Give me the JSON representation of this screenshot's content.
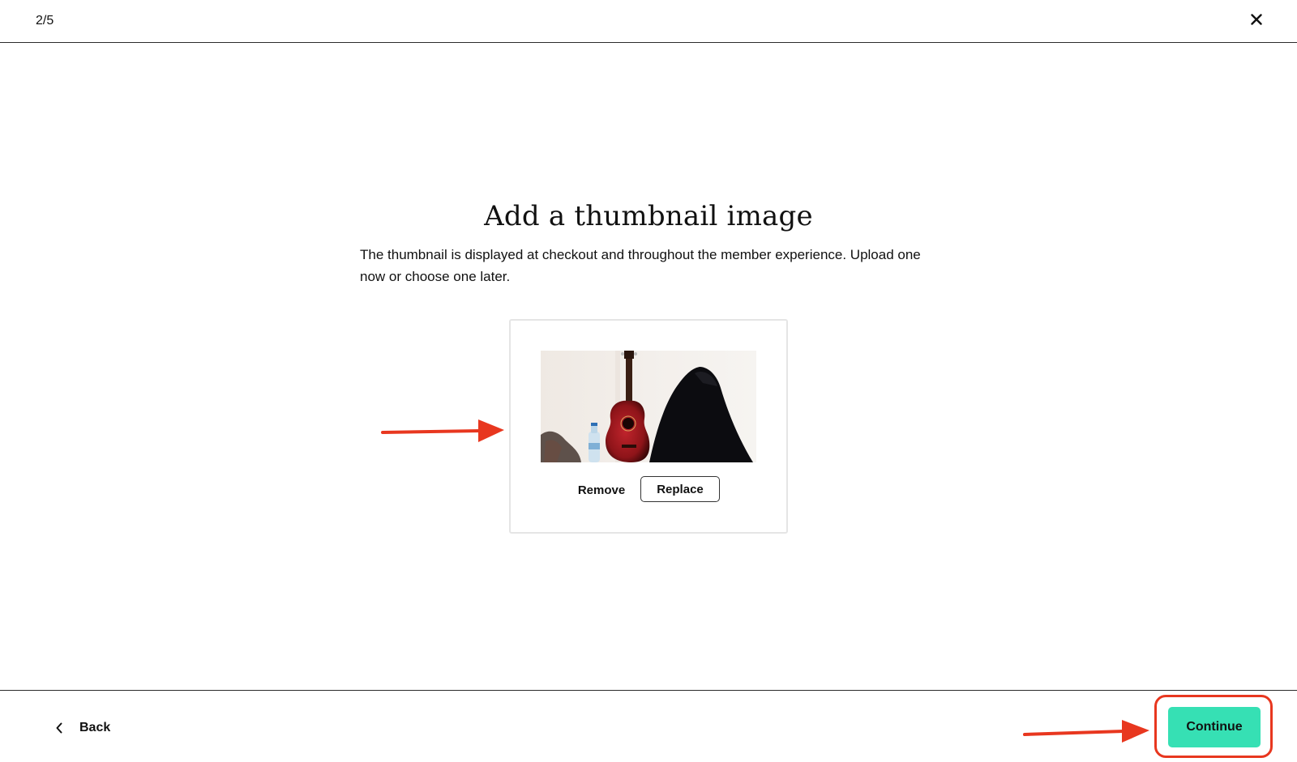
{
  "header": {
    "step_indicator": "2/5",
    "close_icon": "close-icon"
  },
  "main": {
    "title": "Add a thumbnail image",
    "description": "The thumbnail is displayed at checkout and throughout the member experience. Upload one now or choose one later.",
    "thumbnail": {
      "remove_label": "Remove",
      "replace_label": "Replace"
    }
  },
  "footer": {
    "back_label": "Back",
    "back_icon": "chevron-left-icon",
    "continue_label": "Continue"
  },
  "colors": {
    "accent": "#36e0b4",
    "annotation": "#e8371f"
  }
}
